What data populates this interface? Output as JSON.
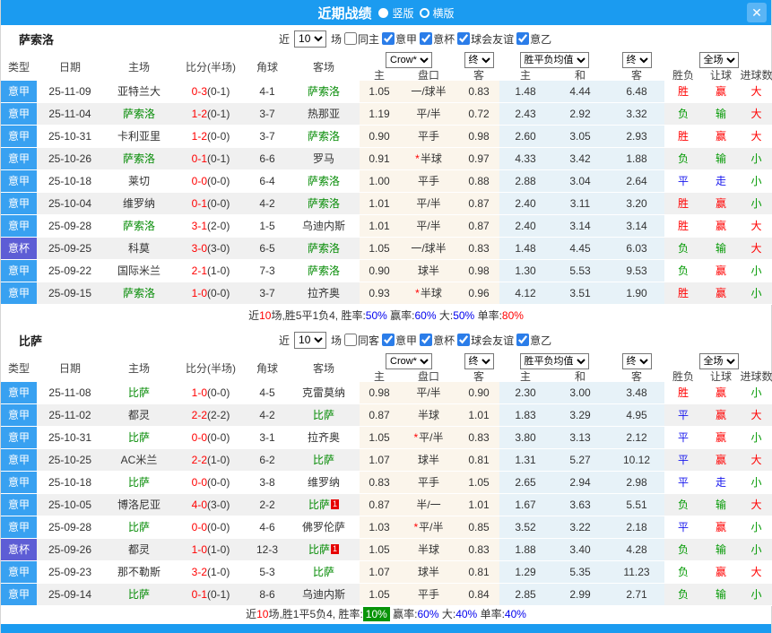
{
  "titlebar": {
    "title": "近期战绩",
    "layout_options": [
      {
        "label": "竖版",
        "selected": true
      },
      {
        "label": "横版",
        "selected": false
      }
    ],
    "close_glyph": "✕"
  },
  "labels": {
    "near": "近",
    "games": "场"
  },
  "table_header": {
    "cols": [
      "类型",
      "日期",
      "主场",
      "比分(半场)",
      "角球",
      "客场"
    ],
    "odds_source_select": "Crow*",
    "final_select_1": "终",
    "avg_select": "胜平负均值",
    "final_select_2": "终",
    "scope_select": "全场",
    "odds_sub": [
      "主",
      "盘口",
      "客"
    ],
    "avg_sub": [
      "主",
      "和",
      "客"
    ],
    "right": [
      "胜负",
      "让球",
      "进球数"
    ]
  },
  "sections": [
    {
      "team": "萨索洛",
      "filter": {
        "count": "10",
        "same": "同主",
        "same_checked": false,
        "leagues": [
          "意甲",
          "意杯",
          "球会友谊",
          "意乙"
        ]
      },
      "rows": [
        {
          "type": "意甲",
          "date": "25-11-09",
          "home": "亚特兰大",
          "home_focus": false,
          "score": "0-3",
          "half": "(0-1)",
          "corners": "4-1",
          "away": "萨索洛",
          "away_focus": true,
          "odds_home": "1.05",
          "handicap": "一/球半",
          "handicap_star": false,
          "odds_away": "0.83",
          "avg_home": "1.48",
          "avg_draw": "4.44",
          "avg_away": "6.48",
          "result": "胜",
          "result_color": "red",
          "handicap_result": "赢",
          "handicap_result_color": "red",
          "goals": "大",
          "goals_color": "red"
        },
        {
          "type": "意甲",
          "date": "25-11-04",
          "home": "萨索洛",
          "home_focus": true,
          "score": "1-2",
          "half": "(0-1)",
          "corners": "3-7",
          "away": "热那亚",
          "away_focus": false,
          "odds_home": "1.19",
          "handicap": "平/半",
          "handicap_star": false,
          "odds_away": "0.72",
          "avg_home": "2.43",
          "avg_draw": "2.92",
          "avg_away": "3.32",
          "result": "负",
          "result_color": "green",
          "handicap_result": "输",
          "handicap_result_color": "green",
          "goals": "大",
          "goals_color": "red"
        },
        {
          "type": "意甲",
          "date": "25-10-31",
          "home": "卡利亚里",
          "home_focus": false,
          "score": "1-2",
          "half": "(0-0)",
          "corners": "3-7",
          "away": "萨索洛",
          "away_focus": true,
          "odds_home": "0.90",
          "handicap": "平手",
          "handicap_star": false,
          "odds_away": "0.98",
          "avg_home": "2.60",
          "avg_draw": "3.05",
          "avg_away": "2.93",
          "result": "胜",
          "result_color": "red",
          "handicap_result": "赢",
          "handicap_result_color": "red",
          "goals": "大",
          "goals_color": "red"
        },
        {
          "type": "意甲",
          "date": "25-10-26",
          "home": "萨索洛",
          "home_focus": true,
          "score": "0-1",
          "half": "(0-1)",
          "corners": "6-6",
          "away": "罗马",
          "away_focus": false,
          "odds_home": "0.91",
          "handicap": "半球",
          "handicap_star": true,
          "odds_away": "0.97",
          "avg_home": "4.33",
          "avg_draw": "3.42",
          "avg_away": "1.88",
          "result": "负",
          "result_color": "green",
          "handicap_result": "输",
          "handicap_result_color": "green",
          "goals": "小",
          "goals_color": "green"
        },
        {
          "type": "意甲",
          "date": "25-10-18",
          "home": "莱切",
          "home_focus": false,
          "score": "0-0",
          "half": "(0-0)",
          "corners": "6-4",
          "away": "萨索洛",
          "away_focus": true,
          "odds_home": "1.00",
          "handicap": "平手",
          "handicap_star": false,
          "odds_away": "0.88",
          "avg_home": "2.88",
          "avg_draw": "3.04",
          "avg_away": "2.64",
          "result": "平",
          "result_color": "blue",
          "handicap_result": "走",
          "handicap_result_color": "blue",
          "goals": "小",
          "goals_color": "green"
        },
        {
          "type": "意甲",
          "date": "25-10-04",
          "home": "维罗纳",
          "home_focus": false,
          "score": "0-1",
          "half": "(0-0)",
          "corners": "4-2",
          "away": "萨索洛",
          "away_focus": true,
          "odds_home": "1.01",
          "handicap": "平/半",
          "handicap_star": false,
          "odds_away": "0.87",
          "avg_home": "2.40",
          "avg_draw": "3.11",
          "avg_away": "3.20",
          "result": "胜",
          "result_color": "red",
          "handicap_result": "赢",
          "handicap_result_color": "red",
          "goals": "小",
          "goals_color": "green"
        },
        {
          "type": "意甲",
          "date": "25-09-28",
          "home": "萨索洛",
          "home_focus": true,
          "score": "3-1",
          "half": "(2-0)",
          "corners": "1-5",
          "away": "乌迪内斯",
          "away_focus": false,
          "odds_home": "1.01",
          "handicap": "平/半",
          "handicap_star": false,
          "odds_away": "0.87",
          "avg_home": "2.40",
          "avg_draw": "3.14",
          "avg_away": "3.14",
          "result": "胜",
          "result_color": "red",
          "handicap_result": "赢",
          "handicap_result_color": "red",
          "goals": "大",
          "goals_color": "red"
        },
        {
          "type": "意杯",
          "date": "25-09-25",
          "home": "科莫",
          "home_focus": false,
          "score": "3-0",
          "half": "(3-0)",
          "corners": "6-5",
          "away": "萨索洛",
          "away_focus": true,
          "odds_home": "1.05",
          "handicap": "一/球半",
          "handicap_star": false,
          "odds_away": "0.83",
          "avg_home": "1.48",
          "avg_draw": "4.45",
          "avg_away": "6.03",
          "result": "负",
          "result_color": "green",
          "handicap_result": "输",
          "handicap_result_color": "green",
          "goals": "大",
          "goals_color": "red"
        },
        {
          "type": "意甲",
          "date": "25-09-22",
          "home": "国际米兰",
          "home_focus": false,
          "score": "2-1",
          "half": "(1-0)",
          "corners": "7-3",
          "away": "萨索洛",
          "away_focus": true,
          "odds_home": "0.90",
          "handicap": "球半",
          "handicap_star": false,
          "odds_away": "0.98",
          "avg_home": "1.30",
          "avg_draw": "5.53",
          "avg_away": "9.53",
          "result": "负",
          "result_color": "green",
          "handicap_result": "赢",
          "handicap_result_color": "red",
          "goals": "小",
          "goals_color": "green"
        },
        {
          "type": "意甲",
          "date": "25-09-15",
          "home": "萨索洛",
          "home_focus": true,
          "score": "1-0",
          "half": "(0-0)",
          "corners": "3-7",
          "away": "拉齐奥",
          "away_focus": false,
          "odds_home": "0.93",
          "handicap": "半球",
          "handicap_star": true,
          "odds_away": "0.96",
          "avg_home": "4.12",
          "avg_draw": "3.51",
          "avg_away": "1.90",
          "result": "胜",
          "result_color": "red",
          "handicap_result": "赢",
          "handicap_result_color": "red",
          "goals": "小",
          "goals_color": "green"
        }
      ],
      "summary": [
        {
          "text": "近",
          "color": "black"
        },
        {
          "text": "10",
          "color": "red"
        },
        {
          "text": "场,胜5平1负4, 胜率:",
          "color": "black"
        },
        {
          "text": "50%",
          "color": "blue"
        },
        {
          "text": " 赢率:",
          "color": "black"
        },
        {
          "text": "60%",
          "color": "blue"
        },
        {
          "text": " 大:",
          "color": "black"
        },
        {
          "text": "50%",
          "color": "blue"
        },
        {
          "text": " 单率:",
          "color": "black"
        },
        {
          "text": "80%",
          "color": "red"
        }
      ]
    },
    {
      "team": "比萨",
      "filter": {
        "count": "10",
        "same": "同客",
        "same_checked": false,
        "leagues": [
          "意甲",
          "意杯",
          "球会友谊",
          "意乙"
        ]
      },
      "rows": [
        {
          "type": "意甲",
          "date": "25-11-08",
          "home": "比萨",
          "home_focus": true,
          "score": "1-0",
          "half": "(0-0)",
          "corners": "4-5",
          "away": "克雷莫纳",
          "away_focus": false,
          "odds_home": "0.98",
          "handicap": "平/半",
          "handicap_star": false,
          "odds_away": "0.90",
          "avg_home": "2.30",
          "avg_draw": "3.00",
          "avg_away": "3.48",
          "result": "胜",
          "result_color": "red",
          "handicap_result": "赢",
          "handicap_result_color": "red",
          "goals": "小",
          "goals_color": "green"
        },
        {
          "type": "意甲",
          "date": "25-11-02",
          "home": "都灵",
          "home_focus": false,
          "score": "2-2",
          "half": "(2-2)",
          "corners": "4-2",
          "away": "比萨",
          "away_focus": true,
          "odds_home": "0.87",
          "handicap": "半球",
          "handicap_star": false,
          "odds_away": "1.01",
          "avg_home": "1.83",
          "avg_draw": "3.29",
          "avg_away": "4.95",
          "result": "平",
          "result_color": "blue",
          "handicap_result": "赢",
          "handicap_result_color": "red",
          "goals": "大",
          "goals_color": "red"
        },
        {
          "type": "意甲",
          "date": "25-10-31",
          "home": "比萨",
          "home_focus": true,
          "score": "0-0",
          "half": "(0-0)",
          "corners": "3-1",
          "away": "拉齐奥",
          "away_focus": false,
          "odds_home": "1.05",
          "handicap": "平/半",
          "handicap_star": true,
          "odds_away": "0.83",
          "avg_home": "3.80",
          "avg_draw": "3.13",
          "avg_away": "2.12",
          "result": "平",
          "result_color": "blue",
          "handicap_result": "赢",
          "handicap_result_color": "red",
          "goals": "小",
          "goals_color": "green"
        },
        {
          "type": "意甲",
          "date": "25-10-25",
          "home": "AC米兰",
          "home_focus": false,
          "score": "2-2",
          "half": "(1-0)",
          "corners": "6-2",
          "away": "比萨",
          "away_focus": true,
          "odds_home": "1.07",
          "handicap": "球半",
          "handicap_star": false,
          "odds_away": "0.81",
          "avg_home": "1.31",
          "avg_draw": "5.27",
          "avg_away": "10.12",
          "result": "平",
          "result_color": "blue",
          "handicap_result": "赢",
          "handicap_result_color": "red",
          "goals": "大",
          "goals_color": "red"
        },
        {
          "type": "意甲",
          "date": "25-10-18",
          "home": "比萨",
          "home_focus": true,
          "score": "0-0",
          "half": "(0-0)",
          "corners": "3-8",
          "away": "维罗纳",
          "away_focus": false,
          "odds_home": "0.83",
          "handicap": "平手",
          "handicap_star": false,
          "odds_away": "1.05",
          "avg_home": "2.65",
          "avg_draw": "2.94",
          "avg_away": "2.98",
          "result": "平",
          "result_color": "blue",
          "handicap_result": "走",
          "handicap_result_color": "blue",
          "goals": "小",
          "goals_color": "green"
        },
        {
          "type": "意甲",
          "date": "25-10-05",
          "home": "博洛尼亚",
          "home_focus": false,
          "score": "4-0",
          "half": "(3-0)",
          "corners": "2-2",
          "away": "比萨",
          "away_focus": true,
          "away_badge": "1",
          "odds_home": "0.87",
          "handicap": "半/一",
          "handicap_star": false,
          "odds_away": "1.01",
          "avg_home": "1.67",
          "avg_draw": "3.63",
          "avg_away": "5.51",
          "result": "负",
          "result_color": "green",
          "handicap_result": "输",
          "handicap_result_color": "green",
          "goals": "大",
          "goals_color": "red"
        },
        {
          "type": "意甲",
          "date": "25-09-28",
          "home": "比萨",
          "home_focus": true,
          "score": "0-0",
          "half": "(0-0)",
          "corners": "4-6",
          "away": "佛罗伦萨",
          "away_focus": false,
          "odds_home": "1.03",
          "handicap": "平/半",
          "handicap_star": true,
          "odds_away": "0.85",
          "avg_home": "3.52",
          "avg_draw": "3.22",
          "avg_away": "2.18",
          "result": "平",
          "result_color": "blue",
          "handicap_result": "赢",
          "handicap_result_color": "red",
          "goals": "小",
          "goals_color": "green"
        },
        {
          "type": "意杯",
          "date": "25-09-26",
          "home": "都灵",
          "home_focus": false,
          "score": "1-0",
          "half": "(1-0)",
          "corners": "12-3",
          "away": "比萨",
          "away_focus": true,
          "away_badge": "1",
          "odds_home": "1.05",
          "handicap": "半球",
          "handicap_star": false,
          "odds_away": "0.83",
          "avg_home": "1.88",
          "avg_draw": "3.40",
          "avg_away": "4.28",
          "result": "负",
          "result_color": "green",
          "handicap_result": "输",
          "handicap_result_color": "green",
          "goals": "小",
          "goals_color": "green"
        },
        {
          "type": "意甲",
          "date": "25-09-23",
          "home": "那不勒斯",
          "home_focus": false,
          "score": "3-2",
          "half": "(1-0)",
          "corners": "5-3",
          "away": "比萨",
          "away_focus": true,
          "odds_home": "1.07",
          "handicap": "球半",
          "handicap_star": false,
          "odds_away": "0.81",
          "avg_home": "1.29",
          "avg_draw": "5.35",
          "avg_away": "11.23",
          "result": "负",
          "result_color": "green",
          "handicap_result": "赢",
          "handicap_result_color": "red",
          "goals": "大",
          "goals_color": "red"
        },
        {
          "type": "意甲",
          "date": "25-09-14",
          "home": "比萨",
          "home_focus": true,
          "score": "0-1",
          "half": "(0-1)",
          "corners": "8-6",
          "away": "乌迪内斯",
          "away_focus": false,
          "odds_home": "1.05",
          "handicap": "平手",
          "handicap_star": false,
          "odds_away": "0.84",
          "avg_home": "2.85",
          "avg_draw": "2.99",
          "avg_away": "2.71",
          "result": "负",
          "result_color": "green",
          "handicap_result": "输",
          "handicap_result_color": "green",
          "goals": "小",
          "goals_color": "green"
        }
      ],
      "summary": [
        {
          "text": "近",
          "color": "black"
        },
        {
          "text": "10",
          "color": "red"
        },
        {
          "text": "场,胜1平5负4, 胜率:",
          "color": "black"
        },
        {
          "text": "10%",
          "color": "greenbadge"
        },
        {
          "text": " 赢率:",
          "color": "black"
        },
        {
          "text": "60%",
          "color": "blue"
        },
        {
          "text": " 大:",
          "color": "black"
        },
        {
          "text": "40%",
          "color": "blue"
        },
        {
          "text": " 单率:",
          "color": "black"
        },
        {
          "text": "40%",
          "color": "blue"
        }
      ]
    }
  ]
}
